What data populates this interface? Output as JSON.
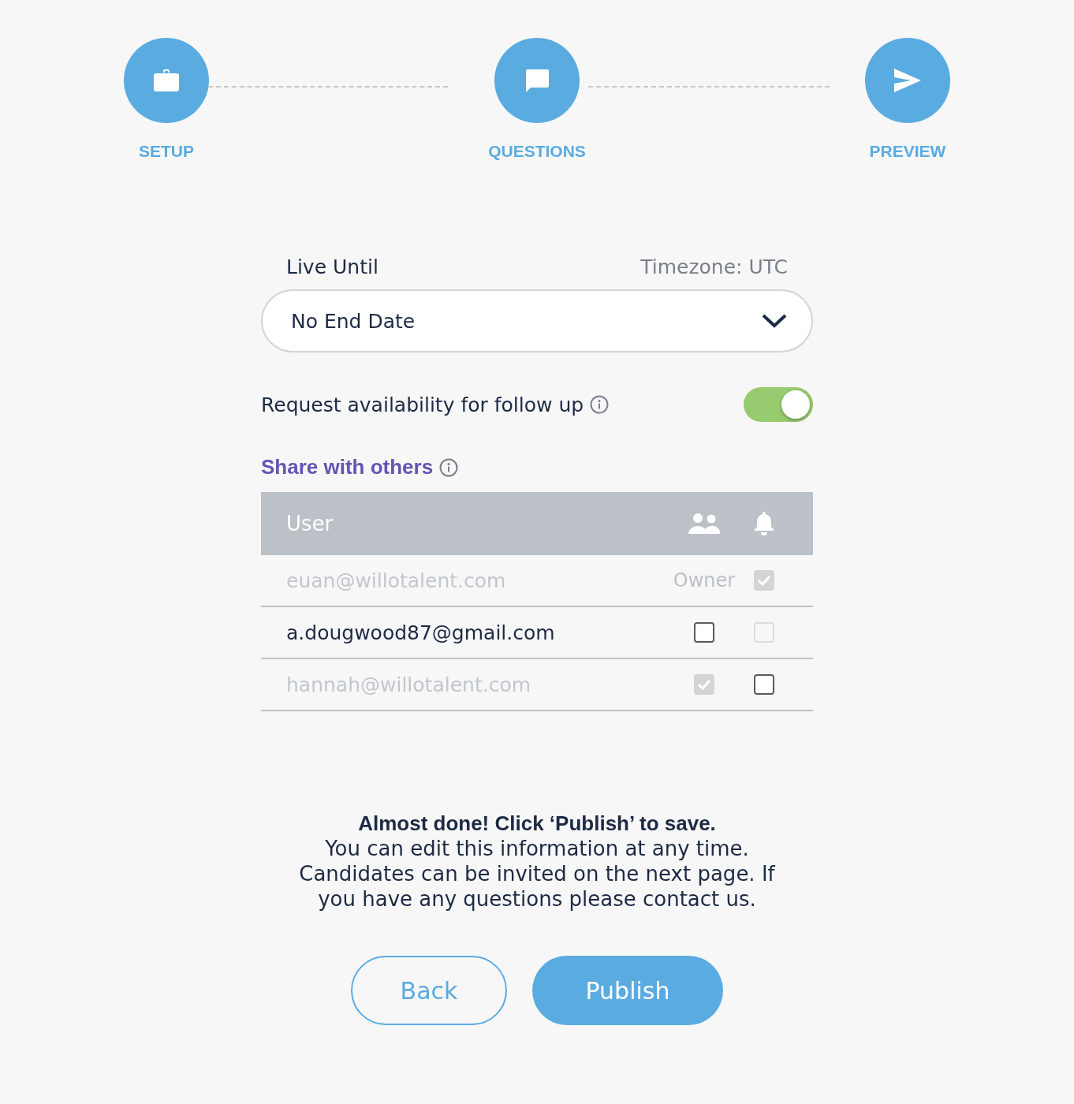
{
  "steps": [
    {
      "label": "SETUP"
    },
    {
      "label": "QUESTIONS"
    },
    {
      "label": "PREVIEW"
    }
  ],
  "live_until": {
    "label": "Live Until",
    "timezone": "Timezone: UTC",
    "value": "No End Date"
  },
  "availability": {
    "label": "Request availability for follow up",
    "on": true
  },
  "share": {
    "title": "Share with others",
    "columns": {
      "user": "User"
    },
    "rows": [
      {
        "email": "euan@willotalent.com",
        "muted": true,
        "share": {
          "kind": "label",
          "text": "Owner"
        },
        "notify": {
          "kind": "checkbox",
          "checked": true,
          "disabled": true
        }
      },
      {
        "email": "a.dougwood87@gmail.com",
        "muted": false,
        "share": {
          "kind": "checkbox",
          "checked": false,
          "disabled": false
        },
        "notify": {
          "kind": "checkbox",
          "checked": false,
          "disabled": true
        }
      },
      {
        "email": "hannah@willotalent.com",
        "muted": true,
        "share": {
          "kind": "checkbox",
          "checked": true,
          "disabled": true
        },
        "notify": {
          "kind": "checkbox",
          "checked": false,
          "disabled": false
        }
      }
    ]
  },
  "message": {
    "heading": "Almost done! Click ‘Publish’ to save.",
    "body": "You can edit this information at any time. Candidates can be invited on the next page. If you have any questions please contact us."
  },
  "buttons": {
    "back": "Back",
    "publish": "Publish"
  }
}
